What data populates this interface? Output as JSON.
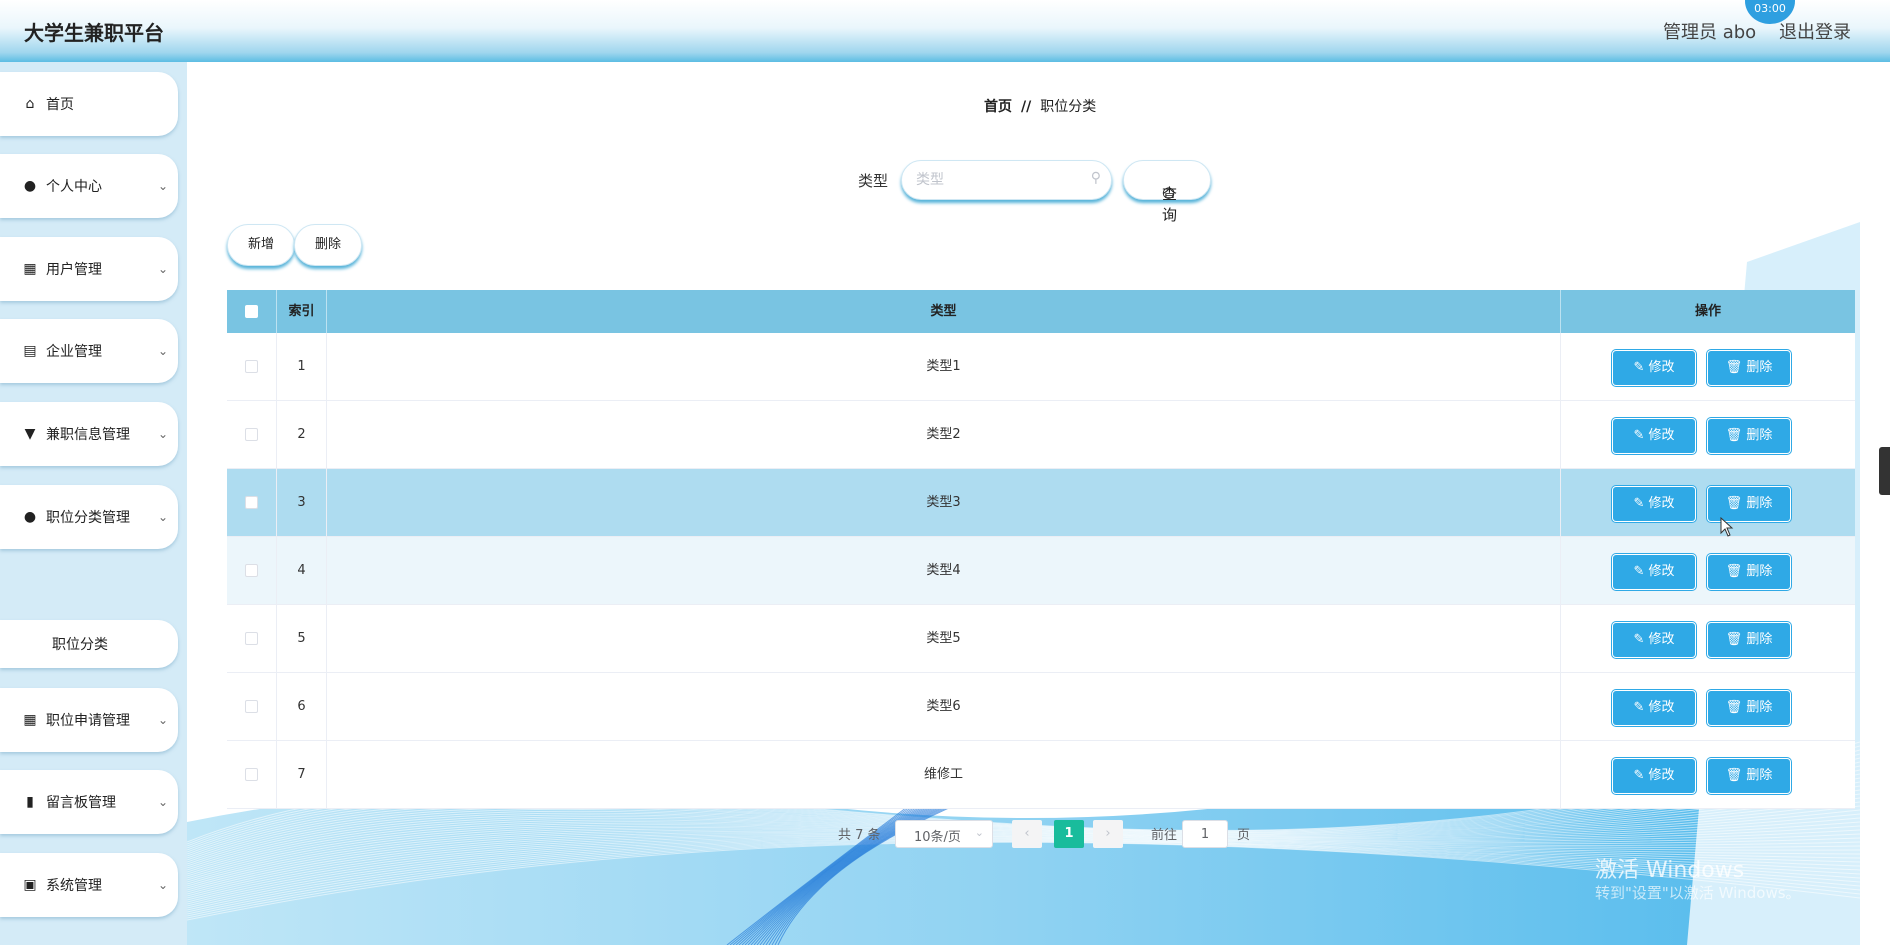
{
  "header": {
    "brand": "大学生兼职平台",
    "user": "管理员 abo",
    "logout": "退出登录",
    "clock": "03:00"
  },
  "sidebar": {
    "items": [
      {
        "label": "首页",
        "icon": "home-icon",
        "glyph": "⌂"
      },
      {
        "label": "个人中心",
        "icon": "user-icon",
        "glyph": "●"
      },
      {
        "label": "用户管理",
        "icon": "grid-icon",
        "glyph": "▦"
      },
      {
        "label": "企业管理",
        "icon": "clipboard-icon",
        "glyph": "▤"
      },
      {
        "label": "兼职信息管理",
        "icon": "stamp-icon",
        "glyph": "▼"
      },
      {
        "label": "职位分类管理",
        "icon": "location-icon",
        "glyph": "●"
      },
      {
        "label": "职位申请管理",
        "icon": "grid-icon",
        "glyph": "▦"
      },
      {
        "label": "留言板管理",
        "icon": "bar-chart-icon",
        "glyph": "▮"
      },
      {
        "label": "系统管理",
        "icon": "calendar-x-icon",
        "glyph": "▣"
      }
    ],
    "sub_item": "职位分类"
  },
  "breadcrumb": {
    "home": "首页",
    "sep": "//",
    "current": "职位分类"
  },
  "search": {
    "label": "类型",
    "placeholder": "类型",
    "query_label": "查询"
  },
  "actions": {
    "add": "新增",
    "delete": "删除"
  },
  "table": {
    "columns": [
      "索引",
      "类型",
      "操作"
    ],
    "edit_label": "修改",
    "delete_label": "删除",
    "rows": [
      {
        "index": "1",
        "type": "类型1"
      },
      {
        "index": "2",
        "type": "类型2"
      },
      {
        "index": "3",
        "type": "类型3"
      },
      {
        "index": "4",
        "type": "类型4"
      },
      {
        "index": "5",
        "type": "类型5"
      },
      {
        "index": "6",
        "type": "类型6"
      },
      {
        "index": "7",
        "type": "维修工"
      }
    ]
  },
  "pagination": {
    "total": "共 7 条",
    "page_size": "10条/页",
    "current_page": "1",
    "goto_label": "前往",
    "goto_value": "1",
    "page_suffix": "页"
  },
  "watermark": {
    "line1": "激活 Windows",
    "line2": "转到\"设置\"以激活 Windows。"
  },
  "colors": {
    "header_accent": "#5cbde3",
    "table_header": "#79c4e2",
    "button": "#2fa9e6",
    "page_active": "#19bc9c",
    "row_hover": "#aedcf0"
  }
}
